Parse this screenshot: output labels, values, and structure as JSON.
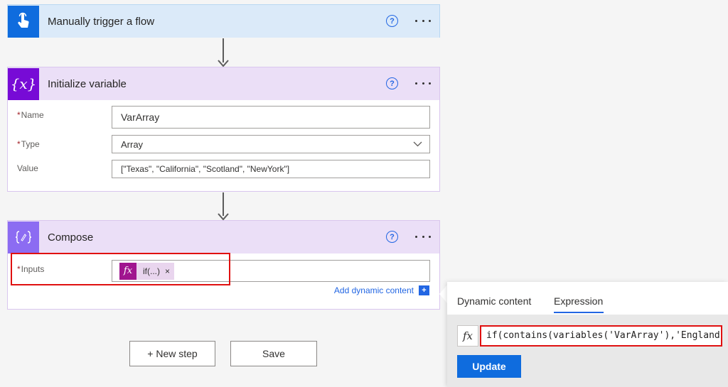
{
  "trigger": {
    "title": "Manually trigger a flow",
    "help": "?"
  },
  "init_variable": {
    "title": "Initialize variable",
    "icon_text": "{x}",
    "help": "?",
    "fields": {
      "name": {
        "label": "Name",
        "value": "VarArray"
      },
      "type": {
        "label": "Type",
        "value": "Array"
      },
      "value": {
        "label": "Value",
        "value": "[\"Texas\", \"California\", \"Scotland\", \"NewYork\"]"
      }
    }
  },
  "compose": {
    "title": "Compose",
    "help": "?",
    "inputs_label": "Inputs",
    "token": {
      "icon": "fx",
      "text": "if(...)",
      "remove": "×"
    },
    "add_dynamic": "Add dynamic content",
    "add_plus": "+"
  },
  "required_mark": "*",
  "buttons": {
    "new_step": "+ New step",
    "save": "Save"
  },
  "panel": {
    "tabs": [
      "Dynamic content",
      "Expression"
    ],
    "active_tab": "Expression",
    "fx": "fx",
    "expression": "if(contains(variables('VarArray'),'England",
    "update": "Update"
  },
  "colors": {
    "trigger_accent": "#0f6cde",
    "variable_accent": "#770bd6",
    "compose_accent": "#8c6cf2",
    "link": "#2266e3",
    "highlight": "#e01010"
  }
}
